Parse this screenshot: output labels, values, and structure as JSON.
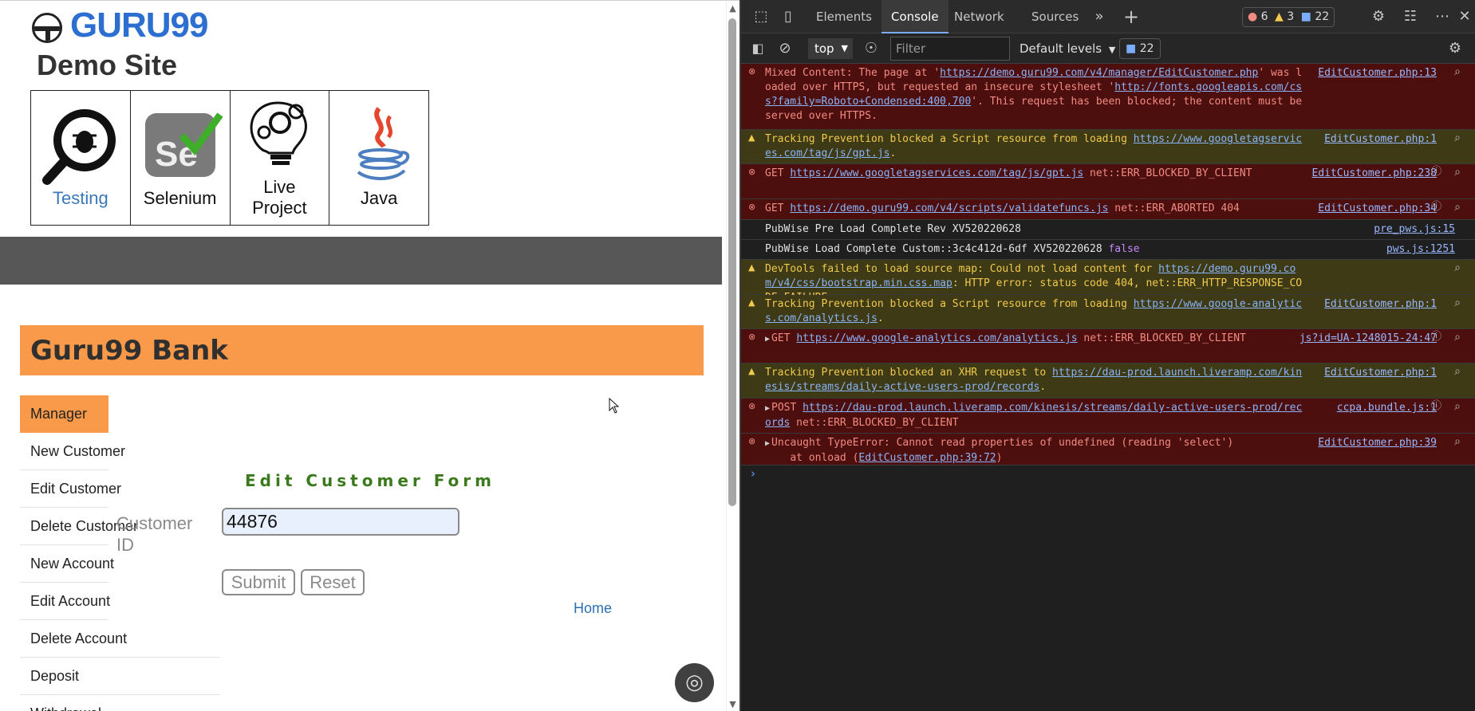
{
  "site": {
    "logo_text": "GURU99",
    "subtitle": "Demo Site",
    "categories": [
      {
        "label": "Testing",
        "icon": "bug-magnifier-icon"
      },
      {
        "label": "Selenium",
        "icon": "selenium-icon"
      },
      {
        "label": "Live\nProject",
        "icon": "lightbulb-gears-icon"
      },
      {
        "label": "Java",
        "icon": "java-icon"
      }
    ],
    "bank_title": "Guru99 Bank",
    "menu": [
      "Manager",
      "New Customer",
      "Edit Customer",
      "Delete Customer",
      "New Account",
      "Edit Account",
      "Delete Account",
      "Deposit",
      "Withdrawal"
    ],
    "form_title": "Edit Customer Form",
    "customer_id_label": "Customer ID",
    "customer_id_value": "44876",
    "submit_label": "Submit",
    "reset_label": "Reset",
    "home_link": "Home"
  },
  "devtools": {
    "tabs": [
      "Elements",
      "Console",
      "Network",
      "Sources"
    ],
    "active_tab": "Console",
    "errors_count": "6",
    "warnings_count": "3",
    "messages_count": "22",
    "context": "top",
    "filter_placeholder": "Filter",
    "levels_label": "Default levels",
    "issues_count": "22",
    "logs": [
      {
        "level": "error",
        "pre": "Mixed Content: The page at '",
        "link": "https://demo.guru99.com/v4/manager/EditCustomer.php",
        "mid": "' was loaded over HTTPS, but requested an insecure stylesheet '",
        "link2": "http://fonts.googleapis.com/css?family=Roboto+Condensed:400,700",
        "post": "'. This request has been blocked; the content must be served over HTTPS.",
        "src": "EditCustomer.php:13"
      },
      {
        "level": "warn",
        "pre": "Tracking Prevention blocked a Script resource from loading ",
        "link": "https://www.googletagservices.com/tag/js/gpt.js",
        "post": ".",
        "src": "EditCustomer.php:1"
      },
      {
        "level": "error",
        "pre": "GET ",
        "link": "https://www.googletagservices.com/tag/js/gpt.js",
        "post": " net::ERR_BLOCKED_BY_CLIENT",
        "src": "EditCustomer.php:238"
      },
      {
        "level": "error",
        "pre": "GET ",
        "link": "https://demo.guru99.com/v4/scripts/validatefuncs.js",
        "post": " net::ERR_ABORTED 404",
        "src": "EditCustomer.php:34"
      },
      {
        "level": "info",
        "pre": "PubWise Pre Load Complete Rev XV520220628",
        "src": "pre_pws.js:15"
      },
      {
        "level": "info",
        "pre": "PubWise Load Complete Custom::3c4c412d-6df XV520220628 ",
        "kw": "false",
        "src": "pws.js:1251"
      },
      {
        "level": "warn",
        "pre": "DevTools failed to load source map: Could not load content for ",
        "link": "https://demo.guru99.com/v4/css/bootstrap.min.css.map",
        "post": ": HTTP error: status code 404, net::ERR_HTTP_RESPONSE_CODE_FAILURE",
        "src": ""
      },
      {
        "level": "warn",
        "pre": "Tracking Prevention blocked a Script resource from loading ",
        "link": "https://www.google-analytics.com/analytics.js",
        "post": ".",
        "src": "EditCustomer.php:1"
      },
      {
        "level": "error",
        "pre": "GET ",
        "link": "https://www.google-analytics.com/analytics.js",
        "post": " net::ERR_BLOCKED_BY_CLIENT",
        "src": "js?id=UA-1248015-24:47"
      },
      {
        "level": "warn",
        "pre": "Tracking Prevention blocked an XHR request to ",
        "link": "https://dau-prod.launch.liveramp.com/kinesis/streams/daily-active-users-prod/records",
        "post": ".",
        "src": "EditCustomer.php:1"
      },
      {
        "level": "error",
        "pre": "POST ",
        "link": "https://dau-prod.launch.liveramp.com/kinesis/streams/daily-active-users-prod/records",
        "post": " net::ERR_BLOCKED_BY_CLIENT",
        "src": "ccpa.bundle.js:1"
      },
      {
        "level": "error",
        "pre": "Uncaught TypeError: Cannot read properties of undefined (reading 'select')\n    at onload (",
        "link": "EditCustomer.php:39:72",
        "post": ")",
        "src": "EditCustomer.php:39"
      }
    ]
  },
  "colors": {
    "accent_orange": "#f89a49",
    "guru_blue": "#2c6fd1",
    "form_green": "#3a7a1c",
    "dark_bar": "#575757"
  }
}
